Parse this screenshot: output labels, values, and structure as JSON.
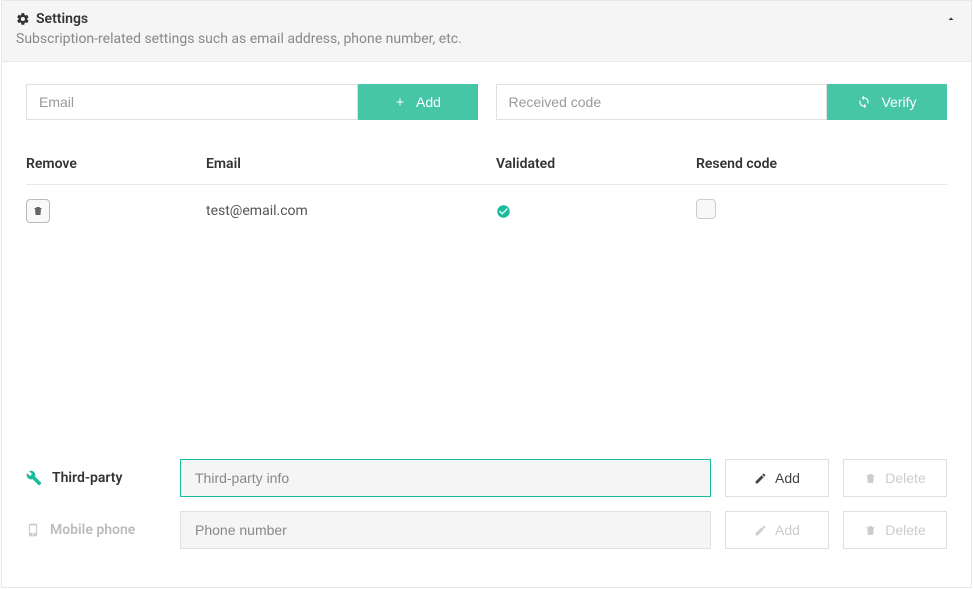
{
  "header": {
    "title": "Settings",
    "subtitle": "Subscription-related settings such as email address, phone number, etc."
  },
  "email_section": {
    "email_placeholder": "Email",
    "add_label": "Add",
    "code_placeholder": "Received code",
    "verify_label": "Verify",
    "columns": {
      "remove": "Remove",
      "email": "Email",
      "validated": "Validated",
      "resend": "Resend code"
    },
    "rows": [
      {
        "email": "test@email.com",
        "validated": true
      }
    ]
  },
  "third_party": {
    "label": "Third-party",
    "placeholder": "Third-party info",
    "add_label": "Add",
    "delete_label": "Delete"
  },
  "mobile": {
    "label": "Mobile phone",
    "placeholder": "Phone number",
    "add_label": "Add",
    "delete_label": "Delete"
  }
}
